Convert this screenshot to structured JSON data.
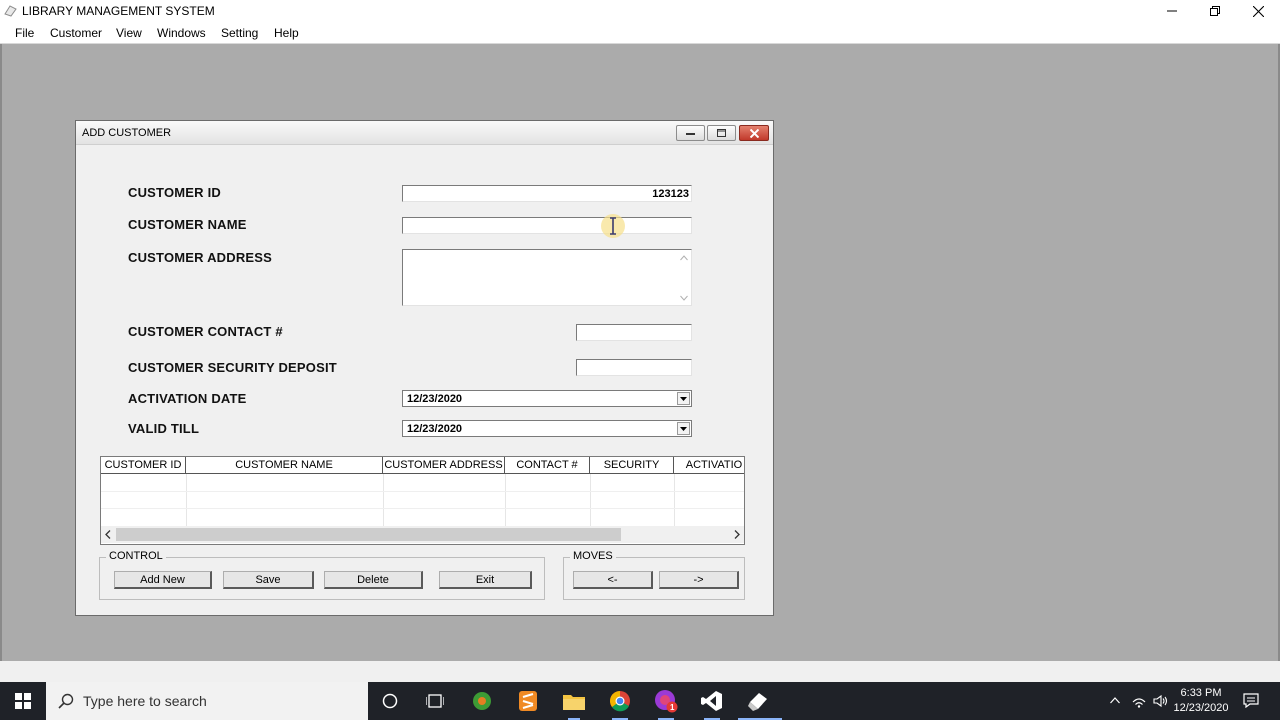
{
  "app": {
    "title": "LIBRARY MANAGEMENT SYSTEM",
    "menu": [
      "File",
      "Customer",
      "View",
      "Windows",
      "Setting",
      "Help"
    ]
  },
  "form": {
    "title": "ADD CUSTOMER",
    "labels": {
      "customer_id": "CUSTOMER ID",
      "customer_name": "CUSTOMER NAME",
      "customer_address": "CUSTOMER ADDRESS",
      "contact": "CUSTOMER CONTACT #",
      "security": "CUSTOMER SECURITY DEPOSIT",
      "activation_date": "ACTIVATION DATE",
      "valid_till": "VALID TILL"
    },
    "values": {
      "customer_id": "123123",
      "customer_name": "",
      "customer_address": "",
      "contact": "",
      "security": "",
      "activation_date": "12/23/2020",
      "valid_till": "12/23/2020"
    },
    "grid": {
      "columns": [
        "CUSTOMER ID",
        "CUSTOMER NAME",
        "CUSTOMER ADDRESS",
        "CONTACT #",
        "SECURITY",
        "ACTIVATIO"
      ],
      "rows": []
    },
    "control_group": {
      "title": "CONTROL",
      "buttons": [
        "Add New",
        "Save",
        "Delete",
        "Exit"
      ]
    },
    "moves_group": {
      "title": "MOVES",
      "buttons": [
        "<-",
        "->"
      ]
    }
  },
  "taskbar": {
    "search_placeholder": "Type here to search",
    "time": "6:33 PM",
    "date": "12/23/2020",
    "icons": [
      "cortana-icon",
      "task-view-icon",
      "app-green-icon",
      "sublime-text-icon",
      "file-explorer-icon",
      "chrome-icon",
      "screen-recorder-icon",
      "visual-studio-icon",
      "notepad-icon"
    ],
    "notification_badge": "1"
  }
}
